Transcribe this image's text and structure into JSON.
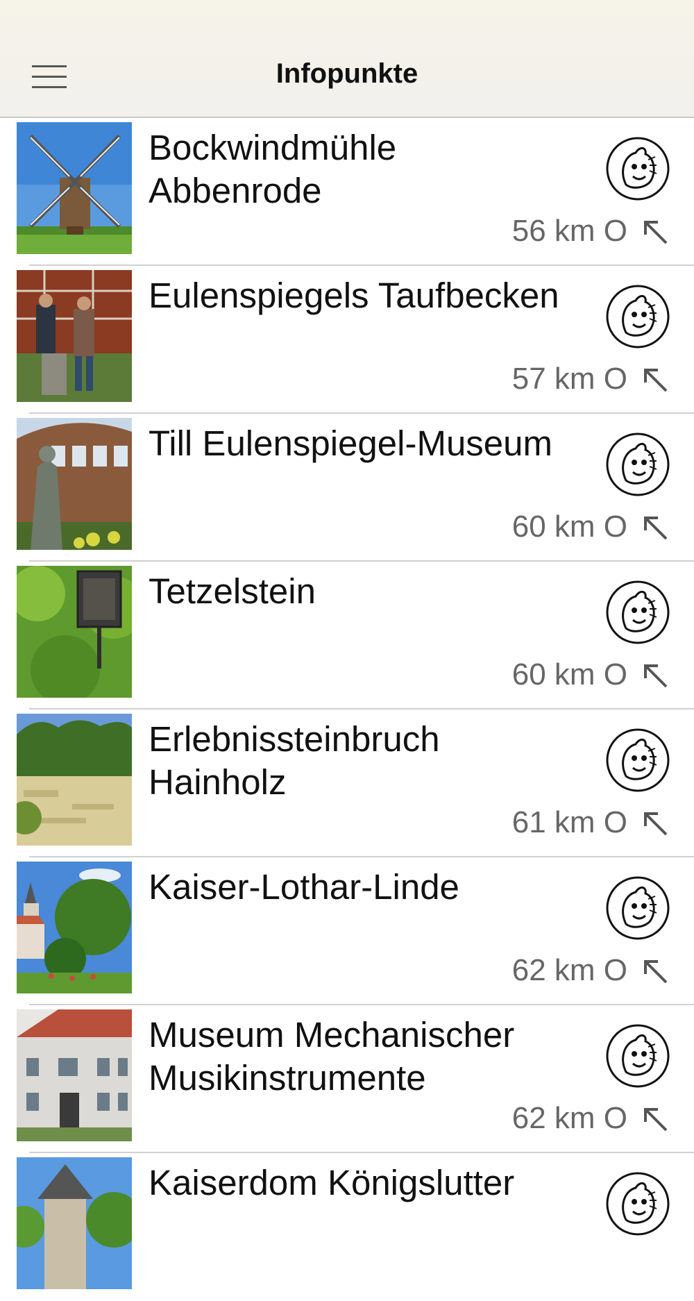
{
  "header": {
    "title": "Infopunkte",
    "menu_icon": "hamburger-menu-icon"
  },
  "items": [
    {
      "name": "Bockwindmühle Abbenrode",
      "distance": "56 km O"
    },
    {
      "name": "Eulenspiegels Taufbecken",
      "distance": "57 km O"
    },
    {
      "name": "Till Eulenspiegel-Museum",
      "distance": "60 km O"
    },
    {
      "name": "Tetzelstein",
      "distance": "60 km O"
    },
    {
      "name": "Erlebnissteinbruch Hainholz",
      "distance": "61 km O"
    },
    {
      "name": "Kaiser-Lothar-Linde",
      "distance": "62 km O"
    },
    {
      "name": "Museum Mechanischer Musikinstrumente",
      "distance": "62 km O"
    },
    {
      "name": "Kaiserdom Königslutter",
      "distance": ""
    }
  ],
  "icons": {
    "badge": "eulenspiegel-mascot-icon",
    "direction": "northwest-arrow-icon"
  },
  "colors": {
    "header_bg": "#f4f2ec",
    "separator": "#d0d0d0",
    "distance_text": "#666666"
  }
}
